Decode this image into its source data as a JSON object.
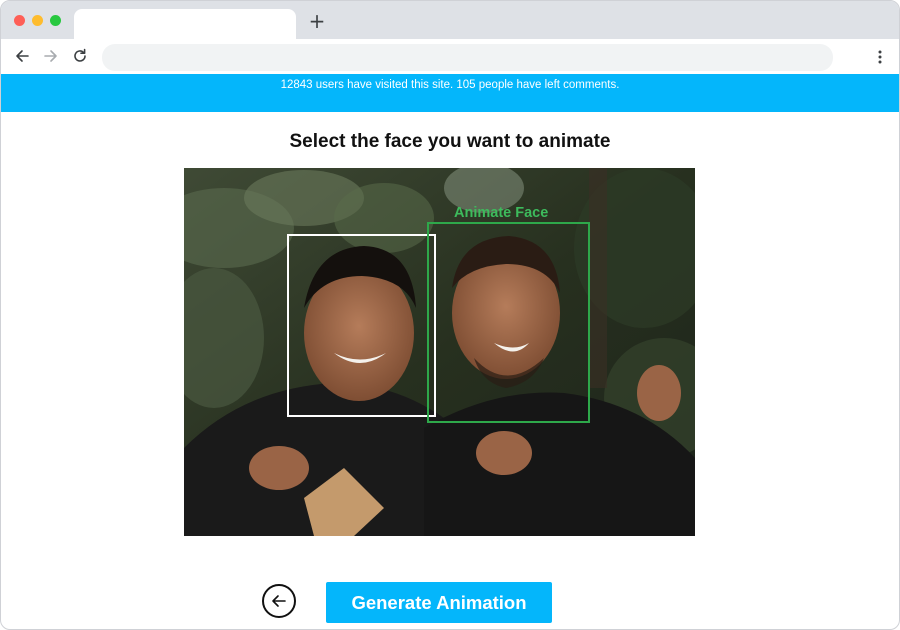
{
  "browser": {
    "new_tab_label": "+",
    "address": ""
  },
  "banner": {
    "text": "12843 users have visited this site. 105 people have left comments."
  },
  "main": {
    "heading": "Select the face you want to animate",
    "face_label": "Animate Face",
    "generate_label": "Generate Animation"
  },
  "icons": {
    "back": "arrow-left-icon",
    "forward": "arrow-right-icon",
    "reload": "reload-icon",
    "menu": "more-vert-icon",
    "back_circle": "arrow-left-circle-icon"
  },
  "colors": {
    "accent": "#04b6fb",
    "selected_face": "#2ea84a",
    "unselected_face": "#ffffff"
  }
}
